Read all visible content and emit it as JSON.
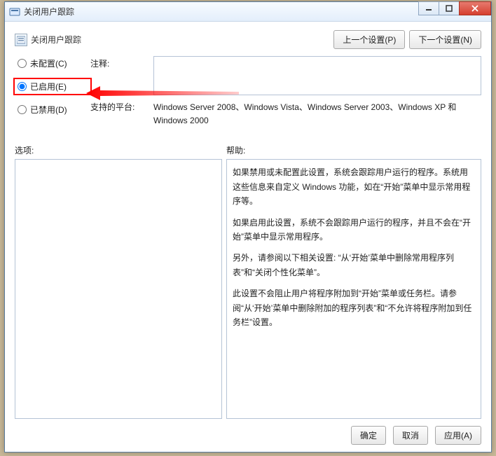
{
  "title": "关闭用户跟踪",
  "header": {
    "title": "关闭用户跟踪"
  },
  "nav": {
    "prev": "上一个设置(P)",
    "next": "下一个设置(N)"
  },
  "radio": {
    "not_configured": "未配置(C)",
    "enabled": "已启用(E)",
    "disabled": "已禁用(D)",
    "selected": "enabled"
  },
  "comment": {
    "label": "注释:",
    "value": ""
  },
  "platform": {
    "label": "支持的平台:",
    "text": "Windows Server 2008、Windows Vista、Windows Server 2003、Windows XP 和 Windows 2000"
  },
  "labels": {
    "options": "选项:",
    "help": "帮助:"
  },
  "help": {
    "p1": "如果禁用或未配置此设置，系统会跟踪用户运行的程序。系统用这些信息来自定义 Windows 功能，如在“开始”菜单中显示常用程序等。",
    "p2": "如果启用此设置，系统不会跟踪用户运行的程序，并且不会在“开始”菜单中显示常用程序。",
    "p3": "另外，请参阅以下相关设置: “从‘开始’菜单中删除常用程序列表”和“关闭个性化菜单”。",
    "p4": "此设置不会阻止用户将程序附加到“开始”菜单或任务栏。请参阅“从‘开始’菜单中删除附加的程序列表”和“不允许将程序附加到任务栏”设置。"
  },
  "buttons": {
    "ok": "确定",
    "cancel": "取消",
    "apply": "应用(A)"
  }
}
